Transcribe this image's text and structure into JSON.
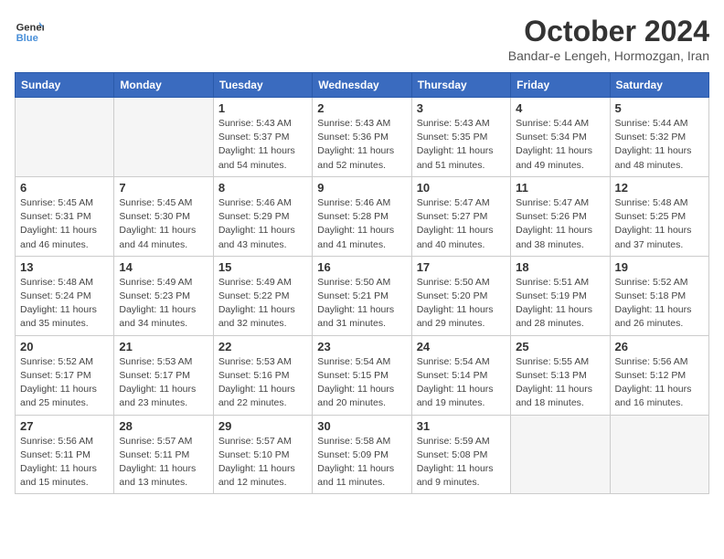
{
  "header": {
    "logo_line1": "General",
    "logo_line2": "Blue",
    "month": "October 2024",
    "location": "Bandar-e Lengeh, Hormozgan, Iran"
  },
  "weekdays": [
    "Sunday",
    "Monday",
    "Tuesday",
    "Wednesday",
    "Thursday",
    "Friday",
    "Saturday"
  ],
  "weeks": [
    [
      {
        "day": "",
        "info": ""
      },
      {
        "day": "",
        "info": ""
      },
      {
        "day": "1",
        "info": "Sunrise: 5:43 AM\nSunset: 5:37 PM\nDaylight: 11 hours and 54 minutes."
      },
      {
        "day": "2",
        "info": "Sunrise: 5:43 AM\nSunset: 5:36 PM\nDaylight: 11 hours and 52 minutes."
      },
      {
        "day": "3",
        "info": "Sunrise: 5:43 AM\nSunset: 5:35 PM\nDaylight: 11 hours and 51 minutes."
      },
      {
        "day": "4",
        "info": "Sunrise: 5:44 AM\nSunset: 5:34 PM\nDaylight: 11 hours and 49 minutes."
      },
      {
        "day": "5",
        "info": "Sunrise: 5:44 AM\nSunset: 5:32 PM\nDaylight: 11 hours and 48 minutes."
      }
    ],
    [
      {
        "day": "6",
        "info": "Sunrise: 5:45 AM\nSunset: 5:31 PM\nDaylight: 11 hours and 46 minutes."
      },
      {
        "day": "7",
        "info": "Sunrise: 5:45 AM\nSunset: 5:30 PM\nDaylight: 11 hours and 44 minutes."
      },
      {
        "day": "8",
        "info": "Sunrise: 5:46 AM\nSunset: 5:29 PM\nDaylight: 11 hours and 43 minutes."
      },
      {
        "day": "9",
        "info": "Sunrise: 5:46 AM\nSunset: 5:28 PM\nDaylight: 11 hours and 41 minutes."
      },
      {
        "day": "10",
        "info": "Sunrise: 5:47 AM\nSunset: 5:27 PM\nDaylight: 11 hours and 40 minutes."
      },
      {
        "day": "11",
        "info": "Sunrise: 5:47 AM\nSunset: 5:26 PM\nDaylight: 11 hours and 38 minutes."
      },
      {
        "day": "12",
        "info": "Sunrise: 5:48 AM\nSunset: 5:25 PM\nDaylight: 11 hours and 37 minutes."
      }
    ],
    [
      {
        "day": "13",
        "info": "Sunrise: 5:48 AM\nSunset: 5:24 PM\nDaylight: 11 hours and 35 minutes."
      },
      {
        "day": "14",
        "info": "Sunrise: 5:49 AM\nSunset: 5:23 PM\nDaylight: 11 hours and 34 minutes."
      },
      {
        "day": "15",
        "info": "Sunrise: 5:49 AM\nSunset: 5:22 PM\nDaylight: 11 hours and 32 minutes."
      },
      {
        "day": "16",
        "info": "Sunrise: 5:50 AM\nSunset: 5:21 PM\nDaylight: 11 hours and 31 minutes."
      },
      {
        "day": "17",
        "info": "Sunrise: 5:50 AM\nSunset: 5:20 PM\nDaylight: 11 hours and 29 minutes."
      },
      {
        "day": "18",
        "info": "Sunrise: 5:51 AM\nSunset: 5:19 PM\nDaylight: 11 hours and 28 minutes."
      },
      {
        "day": "19",
        "info": "Sunrise: 5:52 AM\nSunset: 5:18 PM\nDaylight: 11 hours and 26 minutes."
      }
    ],
    [
      {
        "day": "20",
        "info": "Sunrise: 5:52 AM\nSunset: 5:17 PM\nDaylight: 11 hours and 25 minutes."
      },
      {
        "day": "21",
        "info": "Sunrise: 5:53 AM\nSunset: 5:17 PM\nDaylight: 11 hours and 23 minutes."
      },
      {
        "day": "22",
        "info": "Sunrise: 5:53 AM\nSunset: 5:16 PM\nDaylight: 11 hours and 22 minutes."
      },
      {
        "day": "23",
        "info": "Sunrise: 5:54 AM\nSunset: 5:15 PM\nDaylight: 11 hours and 20 minutes."
      },
      {
        "day": "24",
        "info": "Sunrise: 5:54 AM\nSunset: 5:14 PM\nDaylight: 11 hours and 19 minutes."
      },
      {
        "day": "25",
        "info": "Sunrise: 5:55 AM\nSunset: 5:13 PM\nDaylight: 11 hours and 18 minutes."
      },
      {
        "day": "26",
        "info": "Sunrise: 5:56 AM\nSunset: 5:12 PM\nDaylight: 11 hours and 16 minutes."
      }
    ],
    [
      {
        "day": "27",
        "info": "Sunrise: 5:56 AM\nSunset: 5:11 PM\nDaylight: 11 hours and 15 minutes."
      },
      {
        "day": "28",
        "info": "Sunrise: 5:57 AM\nSunset: 5:11 PM\nDaylight: 11 hours and 13 minutes."
      },
      {
        "day": "29",
        "info": "Sunrise: 5:57 AM\nSunset: 5:10 PM\nDaylight: 11 hours and 12 minutes."
      },
      {
        "day": "30",
        "info": "Sunrise: 5:58 AM\nSunset: 5:09 PM\nDaylight: 11 hours and 11 minutes."
      },
      {
        "day": "31",
        "info": "Sunrise: 5:59 AM\nSunset: 5:08 PM\nDaylight: 11 hours and 9 minutes."
      },
      {
        "day": "",
        "info": ""
      },
      {
        "day": "",
        "info": ""
      }
    ]
  ]
}
